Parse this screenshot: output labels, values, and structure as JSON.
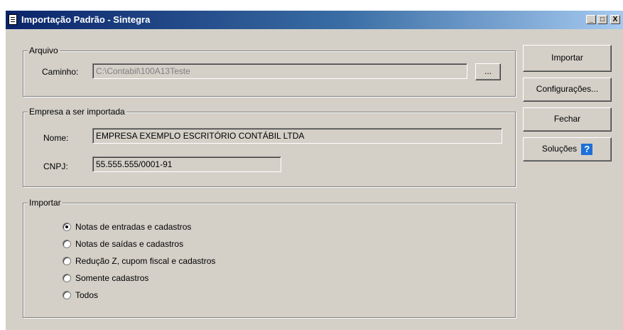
{
  "window": {
    "title": "Importação Padrão - Sintegra",
    "controls": {
      "minimize": "_",
      "maximize": "□",
      "close": "X"
    }
  },
  "arquivo": {
    "legend": "Arquivo",
    "caminho_label": "Caminho:",
    "caminho_value": "C:\\Contabil\\100A13Teste",
    "browse_label": "..."
  },
  "empresa": {
    "legend": "Empresa a ser importada",
    "nome_label": "Nome:",
    "nome_value": "EMPRESA EXEMPLO ESCRITÓRIO CONTÁBIL LTDA",
    "cnpj_label": "CNPJ:",
    "cnpj_value": "55.555.555/0001-91"
  },
  "importar": {
    "legend": "Importar",
    "options": [
      {
        "label": "Notas de entradas e cadastros",
        "checked": true
      },
      {
        "label": "Notas de saídas e cadastros",
        "checked": false
      },
      {
        "label": "Redução Z, cupom fiscal e cadastros",
        "checked": false
      },
      {
        "label": "Somente cadastros",
        "checked": false
      },
      {
        "label": "Todos",
        "checked": false
      }
    ]
  },
  "buttons": {
    "importar": "Importar",
    "configuracoes": "Configurações...",
    "fechar": "Fechar",
    "solucoes": "Soluções",
    "help_glyph": "?"
  },
  "colors": {
    "titlebar_start": "#0a246a",
    "titlebar_end": "#a6caf0",
    "face": "#d4d0c8",
    "help_icon": "#1e6fd9"
  }
}
